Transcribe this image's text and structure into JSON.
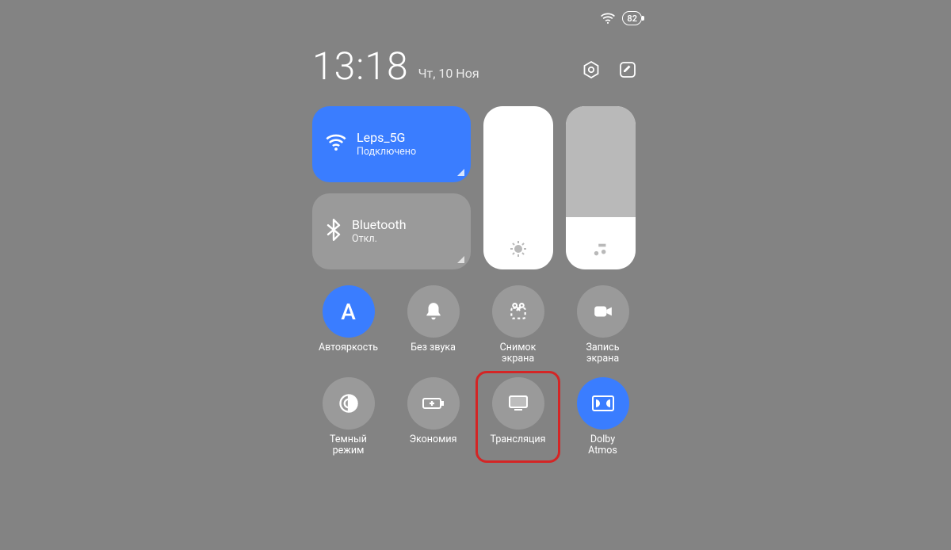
{
  "status": {
    "battery": "82"
  },
  "header": {
    "time": "13:18",
    "date": "Чт, 10 Ноя"
  },
  "wifi": {
    "name": "Leps_5G",
    "status": "Подключено"
  },
  "bluetooth": {
    "name": "Bluetooth",
    "status": "Откл."
  },
  "sliders": {
    "volume_fill_pct": 32
  },
  "quick_tiles": [
    {
      "id": "auto-brightness",
      "label": "Автояркость",
      "active": true,
      "icon": "letter-a"
    },
    {
      "id": "mute",
      "label": "Без звука",
      "active": false,
      "icon": "bell"
    },
    {
      "id": "screenshot",
      "label": "Снимок\nэкрана",
      "active": false,
      "icon": "snip"
    },
    {
      "id": "screen-record",
      "label": "Запись\nэкрана",
      "active": false,
      "icon": "camera"
    },
    {
      "id": "dark-mode",
      "label": "Темный\nрежим",
      "active": false,
      "icon": "contrast"
    },
    {
      "id": "battery-saver",
      "label": "Экономия",
      "active": false,
      "icon": "battery-plus"
    },
    {
      "id": "cast",
      "label": "Трансляция",
      "active": false,
      "icon": "cast",
      "highlighted": true
    },
    {
      "id": "dolby",
      "label": "Dolby\nAtmos",
      "active": true,
      "icon": "dolby"
    }
  ]
}
